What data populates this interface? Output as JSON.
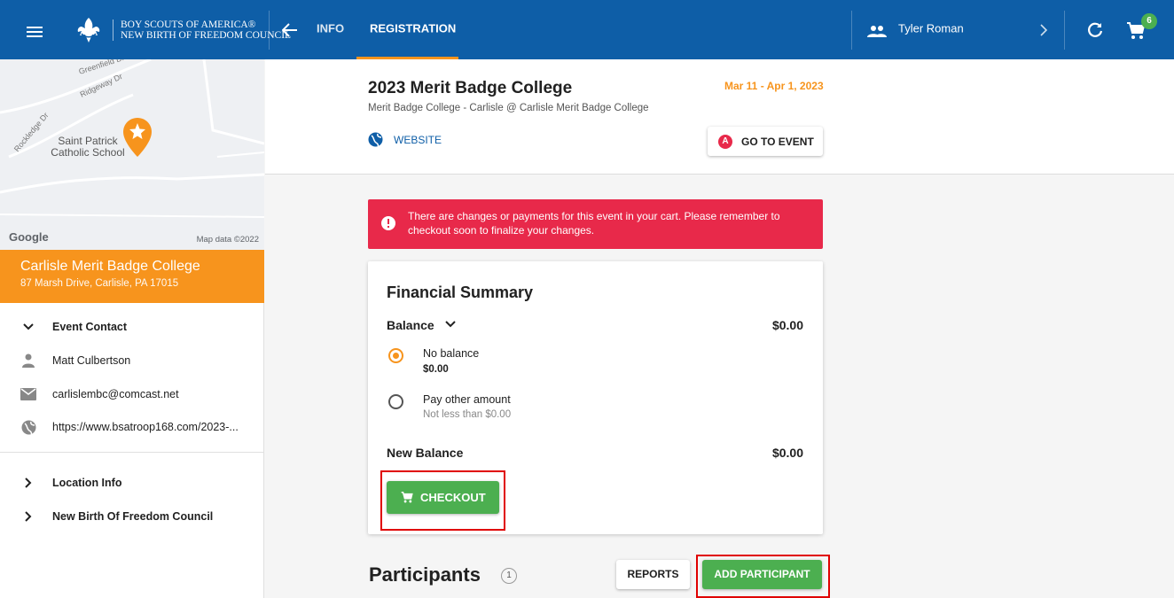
{
  "header": {
    "brand_line1": "BOY SCOUTS OF AMERICA®",
    "brand_line2": "NEW BIRTH OF FREEDOM COUNCIL",
    "tabs": [
      {
        "label": "INFO",
        "active": false
      },
      {
        "label": "REGISTRATION",
        "active": true
      }
    ],
    "user_name": "Tyler Roman",
    "cart_count": "6",
    "colors": {
      "bar": "#0e5ea7",
      "accent": "#f7941d",
      "success": "#4caf50"
    }
  },
  "sidebar": {
    "map": {
      "place_label": "Saint Patrick Catholic School",
      "streets": [
        "Greenfield Dr",
        "Ridgeway Dr",
        "Rockledge Dr"
      ],
      "provider": "Google",
      "attribution": "Map data ©2022"
    },
    "location": {
      "title": "Carlisle Merit Badge College",
      "address": "87 Marsh Drive, Carlisle, PA 17015"
    },
    "event_contact": {
      "heading": "Event Contact",
      "name": "Matt Culbertson",
      "email": "carlislembc@comcast.net",
      "website": "https://www.bsatroop168.com/2023-..."
    },
    "sections": [
      {
        "label": "Location Info"
      },
      {
        "label": "New Birth Of Freedom Council"
      }
    ]
  },
  "event": {
    "title": "2023 Merit Badge College",
    "subtitle": "Merit Badge College - Carlisle @ Carlisle Merit Badge College",
    "date_range": "Mar 11 - Apr 1, 2023",
    "website_label": "WEBSITE",
    "goto_badge": "A",
    "goto_label": "GO TO EVENT"
  },
  "alert": {
    "message": "There are changes or payments for this event in your cart. Please remember to checkout soon to finalize your changes."
  },
  "financial": {
    "title": "Financial Summary",
    "balance_label": "Balance",
    "balance_amount": "$0.00",
    "options": [
      {
        "label": "No balance",
        "sub": "$0.00",
        "selected": true
      },
      {
        "label": "Pay other amount",
        "sub": "Not less than $0.00",
        "selected": false
      }
    ],
    "new_balance_label": "New Balance",
    "new_balance_amount": "$0.00",
    "checkout_label": "CHECKOUT"
  },
  "participants": {
    "title": "Participants",
    "count": "1",
    "reports_label": "REPORTS",
    "add_label": "ADD PARTICIPANT"
  }
}
